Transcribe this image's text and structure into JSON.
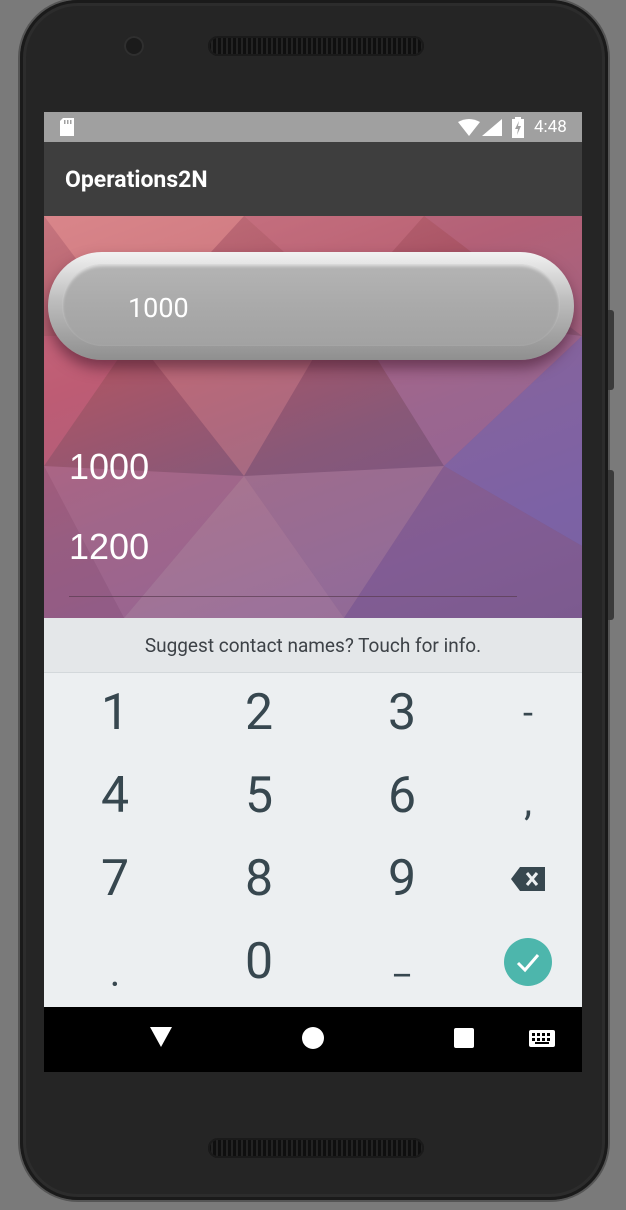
{
  "status_bar": {
    "time": "4:48"
  },
  "app_bar": {
    "title": "Operations2N"
  },
  "result_display": {
    "value": "1000"
  },
  "inputs": [
    {
      "value": "1000"
    },
    {
      "value": "1200"
    }
  ],
  "suggestion_bar": {
    "text": "Suggest contact names? Touch for info."
  },
  "keyboard": {
    "rows": [
      [
        "1",
        "2",
        "3",
        "-"
      ],
      [
        "4",
        "5",
        "6",
        ","
      ],
      [
        "7",
        "8",
        "9",
        "backspace-icon"
      ],
      [
        ".",
        "0",
        "_",
        "done-icon"
      ]
    ]
  },
  "colors": {
    "app_bar": "#3e3e3e",
    "accent": "#ff4081",
    "keyboard_bg": "#eceff1",
    "key_text": "#37474f",
    "done_key": "#4db6ac"
  },
  "nav_bar": {
    "icons": [
      "back-icon",
      "home-icon",
      "recents-icon",
      "keyboard-icon"
    ]
  }
}
